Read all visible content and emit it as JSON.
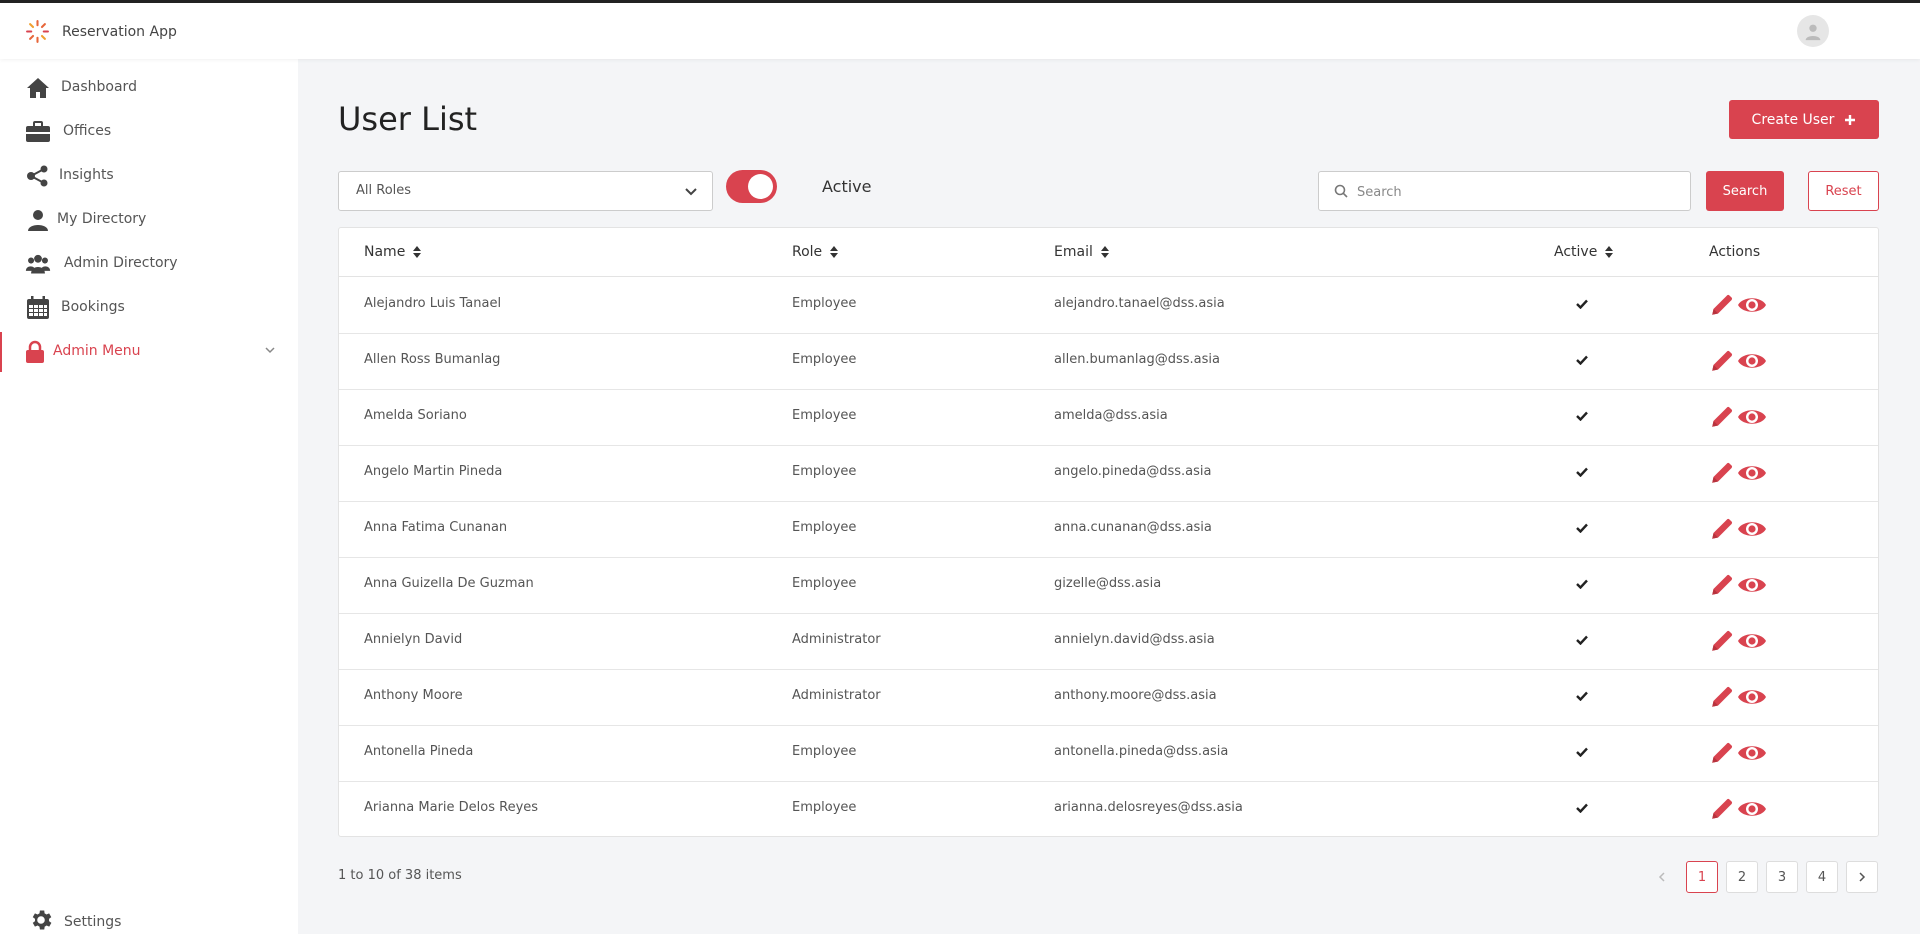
{
  "app": {
    "name": "Reservation App"
  },
  "header": {
    "avatar": "avatar-icon"
  },
  "sidebar": {
    "items": [
      {
        "label": "Dashboard",
        "icon": "home-icon"
      },
      {
        "label": "Offices",
        "icon": "briefcase-icon"
      },
      {
        "label": "Insights",
        "icon": "share-icon"
      },
      {
        "label": "My Directory",
        "icon": "user-icon"
      },
      {
        "label": "Admin Directory",
        "icon": "users-icon"
      },
      {
        "label": "Bookings",
        "icon": "calendar-icon"
      },
      {
        "label": "Admin Menu",
        "icon": "lock-icon",
        "active": true
      }
    ],
    "settings": {
      "label": "Settings",
      "icon": "gear-icon"
    }
  },
  "page": {
    "title": "User List",
    "create_label": "Create User"
  },
  "filters": {
    "role_value": "All Roles",
    "active_label": "Active",
    "active_on": true,
    "search_placeholder": "Search",
    "search_value": "",
    "search_label": "Search",
    "reset_label": "Reset"
  },
  "table": {
    "headers": {
      "name": "Name",
      "role": "Role",
      "email": "Email",
      "active": "Active",
      "actions": "Actions"
    },
    "rows": [
      {
        "name": "Alejandro Luis Tanael",
        "role": "Employee",
        "email": "alejandro.tanael@dss.asia",
        "active": true
      },
      {
        "name": "Allen Ross Bumanlag",
        "role": "Employee",
        "email": "allen.bumanlag@dss.asia",
        "active": true
      },
      {
        "name": "Amelda Soriano",
        "role": "Employee",
        "email": "amelda@dss.asia",
        "active": true
      },
      {
        "name": "Angelo Martin Pineda",
        "role": "Employee",
        "email": "angelo.pineda@dss.asia",
        "active": true
      },
      {
        "name": "Anna Fatima Cunanan",
        "role": "Employee",
        "email": "anna.cunanan@dss.asia",
        "active": true
      },
      {
        "name": "Anna Guizella De Guzman",
        "role": "Employee",
        "email": "gizelle@dss.asia",
        "active": true
      },
      {
        "name": "Annielyn David",
        "role": "Administrator",
        "email": "annielyn.david@dss.asia",
        "active": true
      },
      {
        "name": "Anthony Moore",
        "role": "Administrator",
        "email": "anthony.moore@dss.asia",
        "active": true
      },
      {
        "name": "Antonella Pineda",
        "role": "Employee",
        "email": "antonella.pineda@dss.asia",
        "active": true
      },
      {
        "name": "Arianna Marie Delos Reyes",
        "role": "Employee",
        "email": "arianna.delosreyes@dss.asia",
        "active": true
      }
    ]
  },
  "footer": {
    "items_info": "1 to 10 of 38 items",
    "pages": [
      "1",
      "2",
      "3",
      "4"
    ],
    "current_page": "1"
  },
  "colors": {
    "accent": "#d9434f",
    "background": "#f4f5f7"
  }
}
